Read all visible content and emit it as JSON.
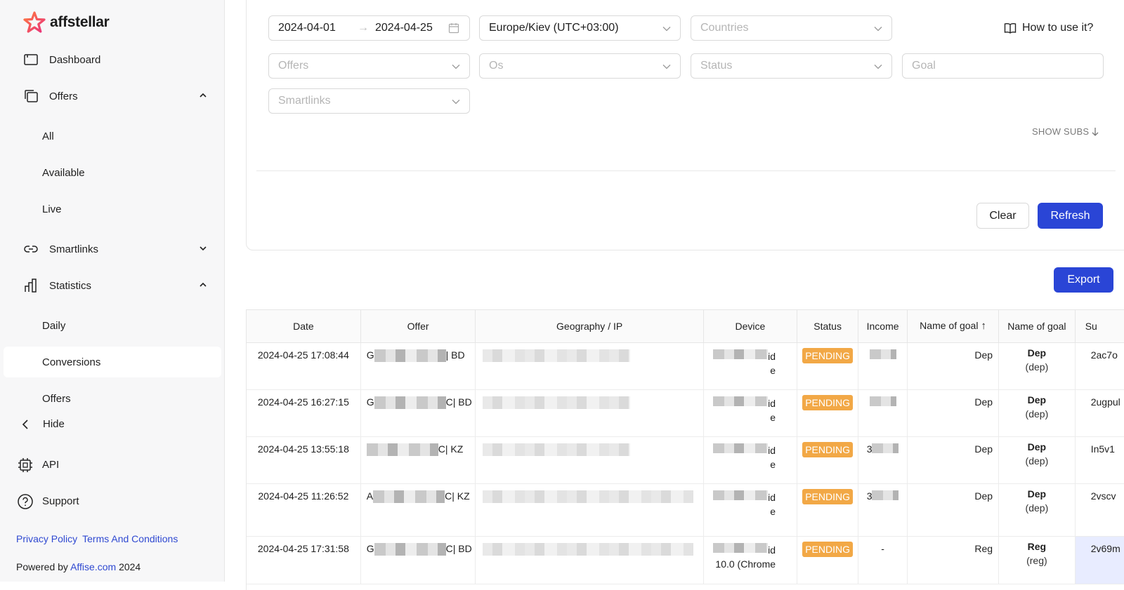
{
  "brand": {
    "name": "affstellar"
  },
  "sidebar": {
    "items": [
      {
        "label": "Dashboard"
      },
      {
        "label": "Offers"
      },
      {
        "label": "Smartlinks"
      },
      {
        "label": "Statistics"
      }
    ],
    "offers_sub": [
      {
        "label": "All"
      },
      {
        "label": "Available"
      },
      {
        "label": "Live"
      }
    ],
    "stats_sub": [
      {
        "label": "Daily"
      },
      {
        "label": "Conversions"
      },
      {
        "label": "Offers"
      }
    ],
    "hide_label": "Hide",
    "api_label": "API",
    "support_label": "Support",
    "privacy_label": "Privacy Policy",
    "terms_label": "Terms And Conditions",
    "powered_prefix": "Powered by",
    "powered_link": "Affise.com",
    "powered_year": "2024"
  },
  "filters": {
    "date_from": "2024-04-01",
    "date_arrow": "→",
    "date_to": "2024-04-25",
    "timezone": "Europe/Kiev (UTC+03:00)",
    "countries_placeholder": "Countries",
    "offers_placeholder": "Offers",
    "os_placeholder": "Os",
    "status_placeholder": "Status",
    "goal_placeholder": "Goal",
    "smartlinks_placeholder": "Smartlinks",
    "how_to_use": "How to use it?",
    "show_subs": "SHOW SUBS",
    "clear_label": "Clear",
    "refresh_label": "Refresh"
  },
  "export_label": "Export",
  "table": {
    "columns": [
      "Date",
      "Offer",
      "Geography / IP",
      "Device",
      "Status",
      "Income",
      "Name of goal",
      "Name of goal",
      "Su"
    ],
    "sort_indicator": "↑",
    "rows": [
      {
        "date": "2024-04-25 17:08:44",
        "offer_prefix": "G",
        "offer_suffix": "| BD",
        "device_a": "id",
        "device_b": "e",
        "status": "PENDING",
        "income": "",
        "goal1": "Dep",
        "goal2_main": "Dep",
        "goal2_sub": "(dep)",
        "sub": "2ac7o"
      },
      {
        "date": "2024-04-25 16:27:15",
        "offer_prefix": "G",
        "offer_suffix": "C| BD",
        "device_a": "id",
        "device_b": "e",
        "status": "PENDING",
        "income": "",
        "goal1": "Dep",
        "goal2_main": "Dep",
        "goal2_sub": "(dep)",
        "sub": "2ugpul"
      },
      {
        "date": "2024-04-25 13:55:18",
        "offer_prefix": "",
        "offer_suffix": "C| KZ",
        "device_a": "id",
        "device_b": "e",
        "status": "PENDING",
        "income": "3",
        "goal1": "Dep",
        "goal2_main": "Dep",
        "goal2_sub": "(dep)",
        "sub": "In5v1"
      },
      {
        "date": "2024-04-25 11:26:52",
        "offer_prefix": "A",
        "offer_suffix": "C| KZ",
        "device_a": "id",
        "device_b": "e",
        "status": "PENDING",
        "income": "3",
        "goal1": "Dep",
        "goal2_main": "Dep",
        "goal2_sub": "(dep)",
        "sub": "2vscv"
      },
      {
        "date": "2024-04-25 17:31:58",
        "offer_prefix": "G",
        "offer_suffix": "C| BD",
        "device_a": "id",
        "device_b": "10.0 (Chrome",
        "status": "PENDING",
        "income": "-",
        "goal1": "Reg",
        "goal2_main": "Reg",
        "goal2_sub": "(reg)",
        "sub": "2v69m"
      }
    ]
  },
  "colors": {
    "accent": "#2a45d6",
    "pending": "#f2a846",
    "link": "#2f49d1"
  }
}
